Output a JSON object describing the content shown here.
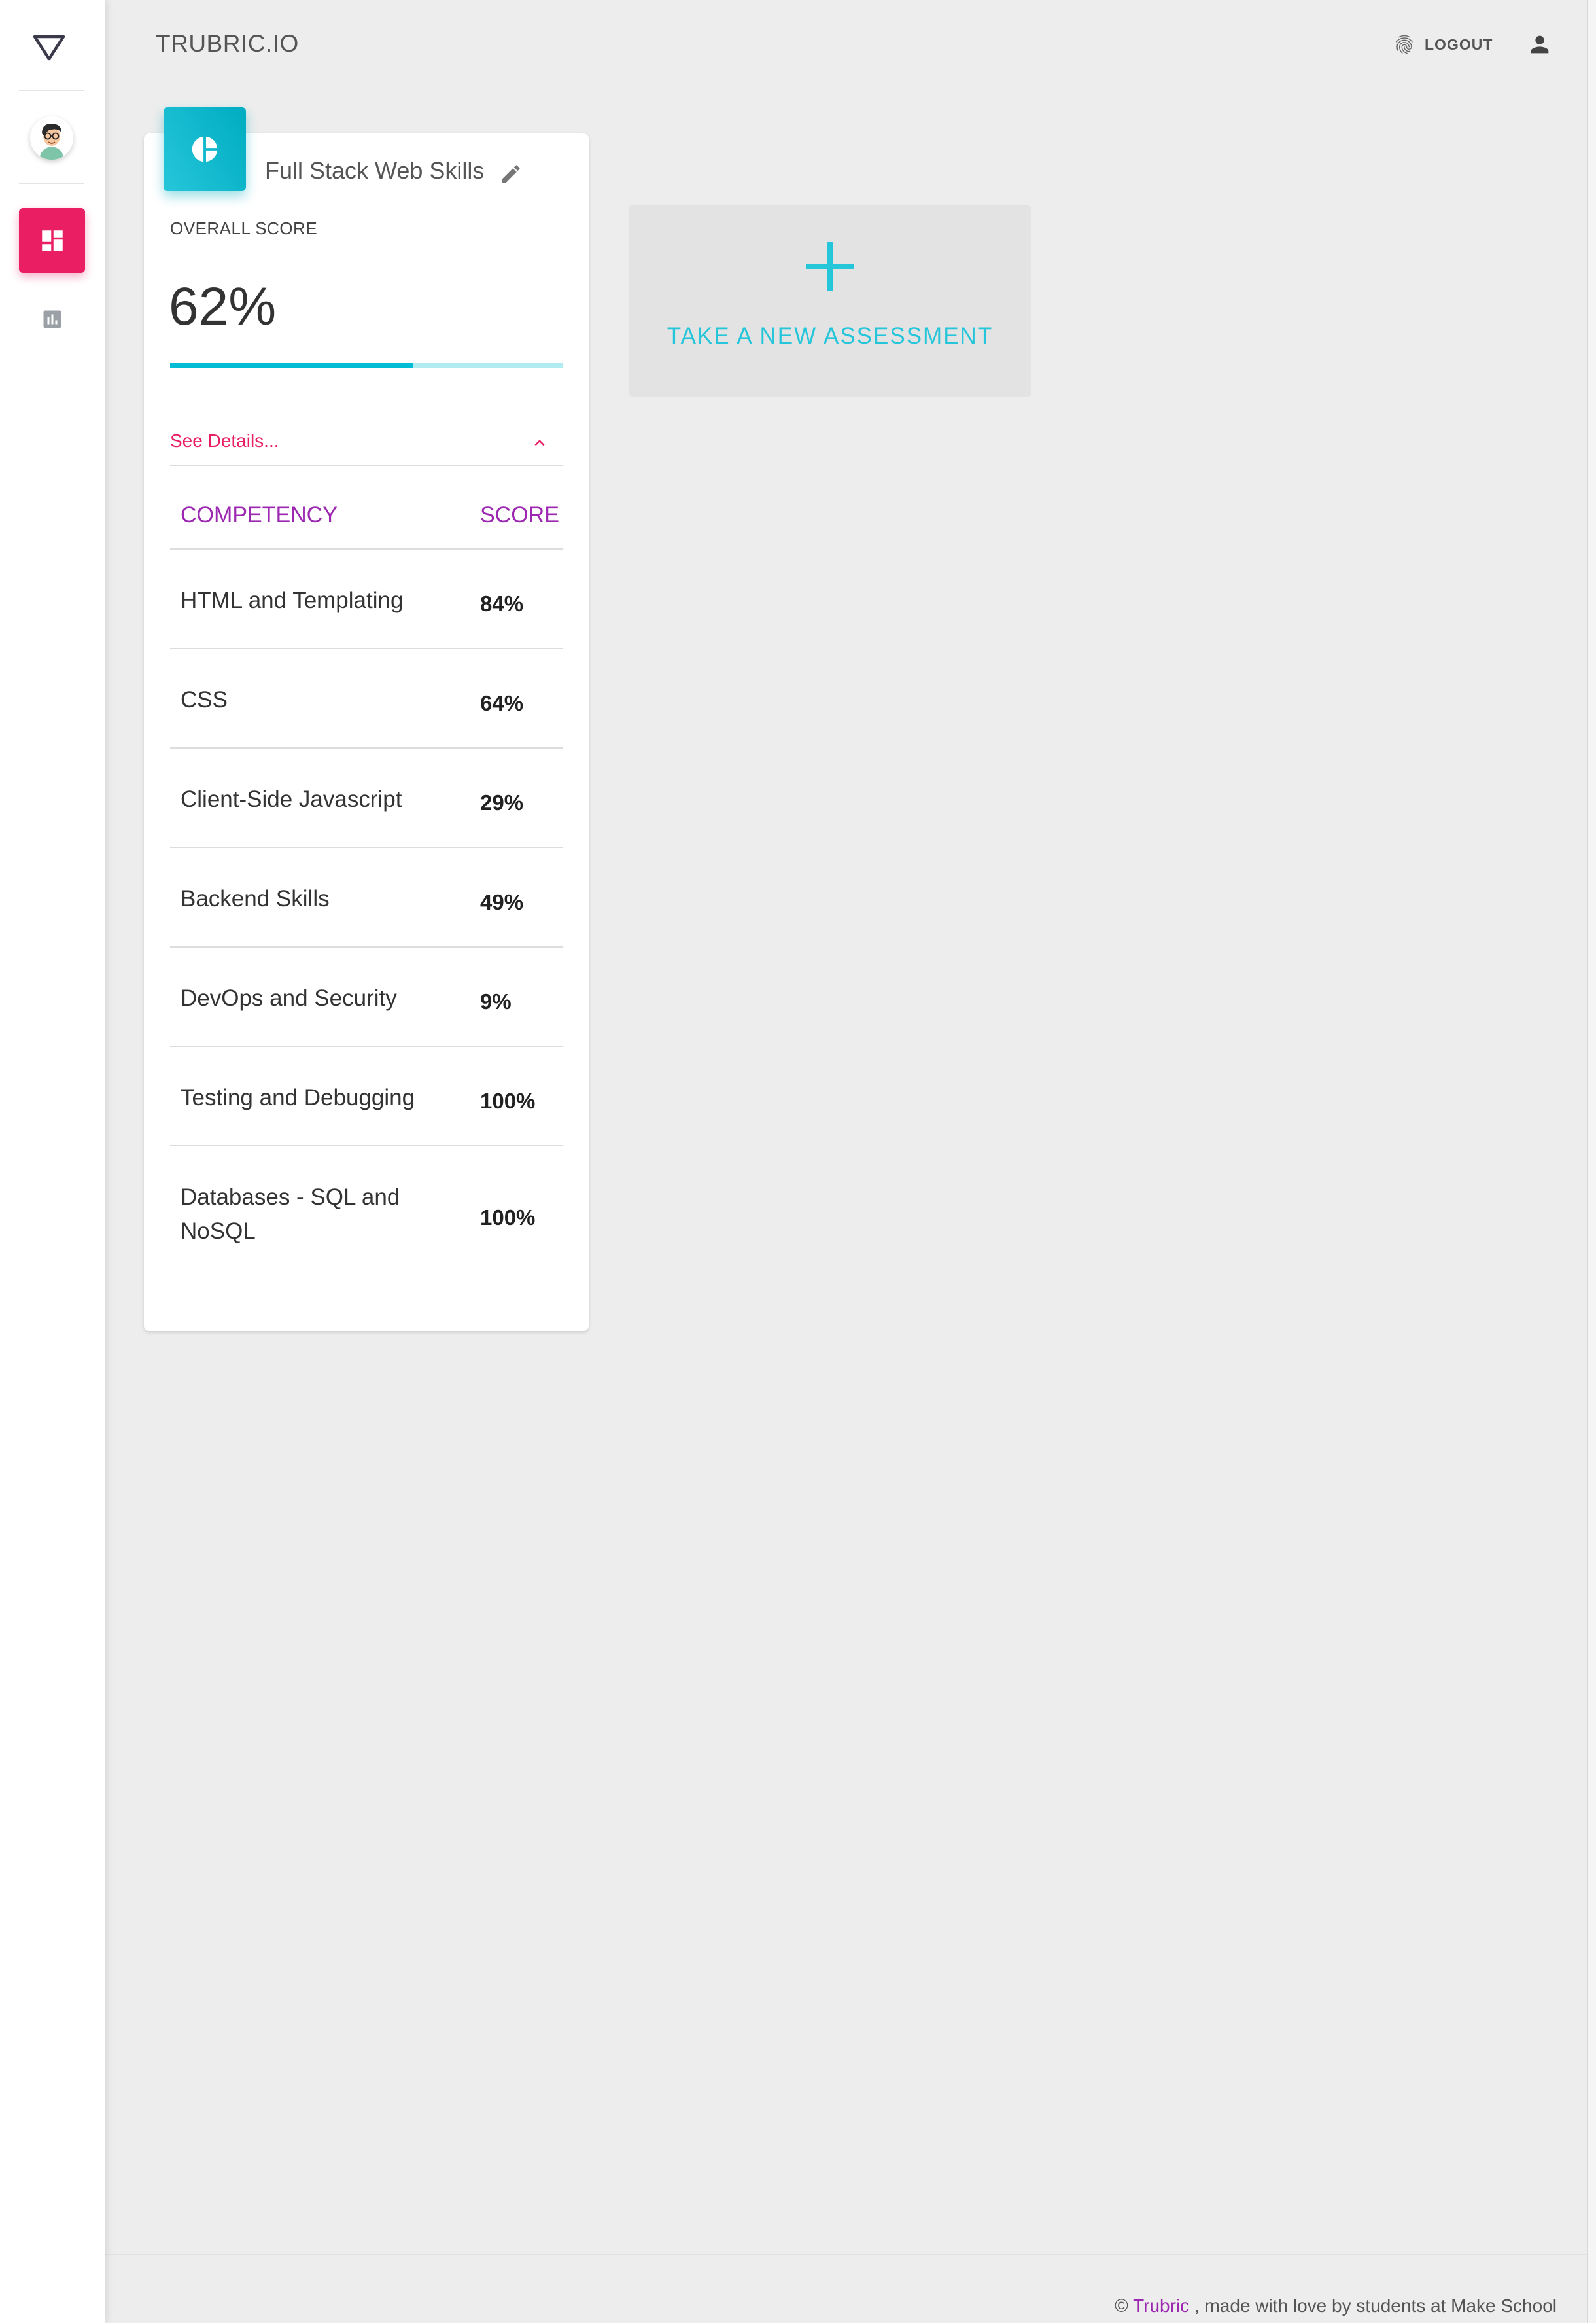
{
  "brand": "TRUBRIC.IO",
  "header": {
    "logout_label": "LOGOUT"
  },
  "assessment": {
    "title": "Full Stack Web Skills",
    "overall_label": "OVERALL SCORE",
    "overall_value": "62%",
    "overall_fraction": 0.62,
    "see_details": "See Details...",
    "columns": {
      "competency": "COMPETENCY",
      "score": "SCORE"
    },
    "rows": [
      {
        "name": "HTML and Templating",
        "score": "84%"
      },
      {
        "name": "CSS",
        "score": "64%"
      },
      {
        "name": "Client-Side Javascript",
        "score": "29%"
      },
      {
        "name": "Backend Skills",
        "score": "49%"
      },
      {
        "name": "DevOps and Security",
        "score": "9%"
      },
      {
        "name": "Testing and Debugging",
        "score": "100%"
      },
      {
        "name": "Databases - SQL and NoSQL",
        "score": "100%"
      }
    ]
  },
  "new_assessment": {
    "label": "TAKE A NEW ASSESSMENT"
  },
  "footer": {
    "copyright": "©",
    "link": "Trubric",
    "text": ", made with love by students at Make School"
  },
  "colors": {
    "accent_pink": "#e91e63",
    "accent_cyan": "#00bcd4",
    "accent_purple": "#9c27b0"
  },
  "icons": {
    "logo": "triangle-down-logo-icon",
    "dashboard": "dashboard-icon",
    "stats": "bar-chart-icon",
    "fingerprint": "fingerprint-icon",
    "user": "person-icon",
    "card": "pie-chart-icon",
    "edit": "pencil-icon",
    "chevron": "chevron-up-icon",
    "add": "plus-icon"
  }
}
